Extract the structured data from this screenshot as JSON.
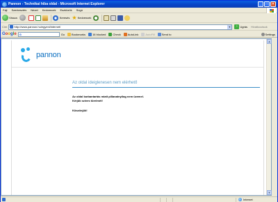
{
  "window": {
    "title": "Pannon - Technikai hiba oldal - Microsoft Internet Explorer",
    "buttons": {
      "minimize": "_",
      "maximize": "□",
      "close": "×"
    }
  },
  "menubar": {
    "items": [
      "Fájl",
      "Szerkesztés",
      "Nézet",
      "Kedvencek",
      "Eszközök",
      "Súgó"
    ]
  },
  "toolbar": {
    "back_label": "Vissza",
    "search_label": "Keresés",
    "favorites_label": "Kedvencek"
  },
  "addressbar": {
    "label": "Cím",
    "url": "http://www.pannon.hu/egyeni/internet/",
    "go_label": "Ugrás",
    "links_label": "Hivatkozások"
  },
  "google_toolbar": {
    "logo": "Google",
    "search_mini": "G",
    "go_label": "Go",
    "bookmarks_label": "Bookmarks",
    "blocked_label": "16 blocked",
    "check_label": "Check",
    "autolink_label": "AutoLink",
    "autofill_label": "AutoFill",
    "sendto_label": "Send to",
    "settings_label": "Settings"
  },
  "page": {
    "brand": "pannon",
    "heading": "Az oldal ideiglenesen nem elérhető",
    "line1": "Az oldal karbantartás miatt pillanatnyilag nem üzemel.",
    "line2": "Kérjük szíves türelmét!",
    "closing": "Köszönjük!"
  },
  "statusbar": {
    "zone": "Internet"
  },
  "colors": {
    "brand_blue": "#2aa9e8",
    "heading_blue": "#5b9bc4",
    "rule_blue": "#3b8ec6",
    "titlebar_blue": "#0a5fe0"
  }
}
